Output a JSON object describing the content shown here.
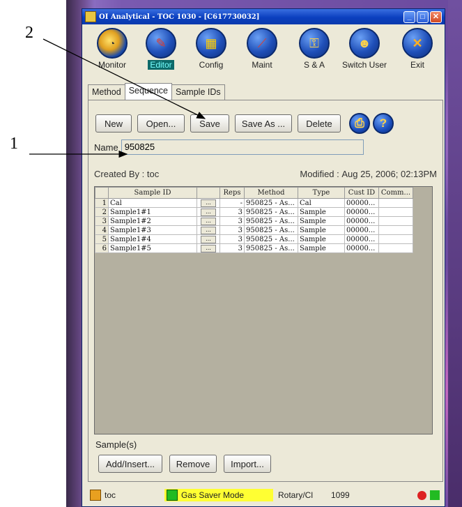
{
  "window": {
    "title": "OI Analytical - TOC 1030 - [C617730032]"
  },
  "toolbar": [
    {
      "label": "Monitor",
      "icon": "gauge-icon",
      "selected": false
    },
    {
      "label": "Editor",
      "icon": "pencil-icon",
      "selected": true
    },
    {
      "label": "Config",
      "icon": "grid-icon",
      "selected": false
    },
    {
      "label": "Maint",
      "icon": "screwdriver-icon",
      "selected": false
    },
    {
      "label": "S & A",
      "icon": "key-icon",
      "selected": false
    },
    {
      "label": "Switch User",
      "icon": "users-icon",
      "selected": false
    },
    {
      "label": "Exit",
      "icon": "close-icon",
      "selected": false
    }
  ],
  "tabs": [
    "Method",
    "Sequence",
    "Sample IDs"
  ],
  "active_tab": "Sequence",
  "buttons": {
    "new": "New",
    "open": "Open...",
    "save": "Save",
    "save_as": "Save As ...",
    "delete": "Delete"
  },
  "name": {
    "label": "Name",
    "value": "950825"
  },
  "created": {
    "label": "Created By :",
    "by": "toc",
    "modified_label": "Modified :",
    "modified": "Aug 25, 2006; 02:13PM"
  },
  "table": {
    "headers": [
      "",
      "Sample ID",
      "",
      "Reps",
      "Method",
      "Type",
      "Cust ID",
      "Comm..."
    ],
    "rows": [
      {
        "n": "1",
        "id": "Cal",
        "reps": "-",
        "method": "950825 - As...",
        "type": "Cal",
        "cust": "00000..."
      },
      {
        "n": "2",
        "id": "Sample1#1",
        "reps": "3",
        "method": "950825 - As...",
        "type": "Sample",
        "cust": "00000..."
      },
      {
        "n": "3",
        "id": "Sample1#2",
        "reps": "3",
        "method": "950825 - As...",
        "type": "Sample",
        "cust": "00000..."
      },
      {
        "n": "4",
        "id": "Sample1#3",
        "reps": "3",
        "method": "950825 - As...",
        "type": "Sample",
        "cust": "00000..."
      },
      {
        "n": "5",
        "id": "Sample1#4",
        "reps": "3",
        "method": "950825 - As...",
        "type": "Sample",
        "cust": "00000..."
      },
      {
        "n": "6",
        "id": "Sample1#5",
        "reps": "3",
        "method": "950825 - As...",
        "type": "Sample",
        "cust": "00000..."
      }
    ]
  },
  "samples": {
    "label": "Sample(s)",
    "add": "Add/Insert...",
    "remove": "Remove",
    "import": "Import..."
  },
  "status": {
    "user": "toc",
    "mode": "Gas Saver Mode",
    "valve": "Rotary/Cl",
    "count": "1099"
  },
  "callouts": {
    "one": "1",
    "two": "2"
  },
  "colors": {
    "title_bar": "#0b3fbf",
    "mode_highlight": "#ffff33",
    "selected_tool": "#0d6a6a"
  }
}
